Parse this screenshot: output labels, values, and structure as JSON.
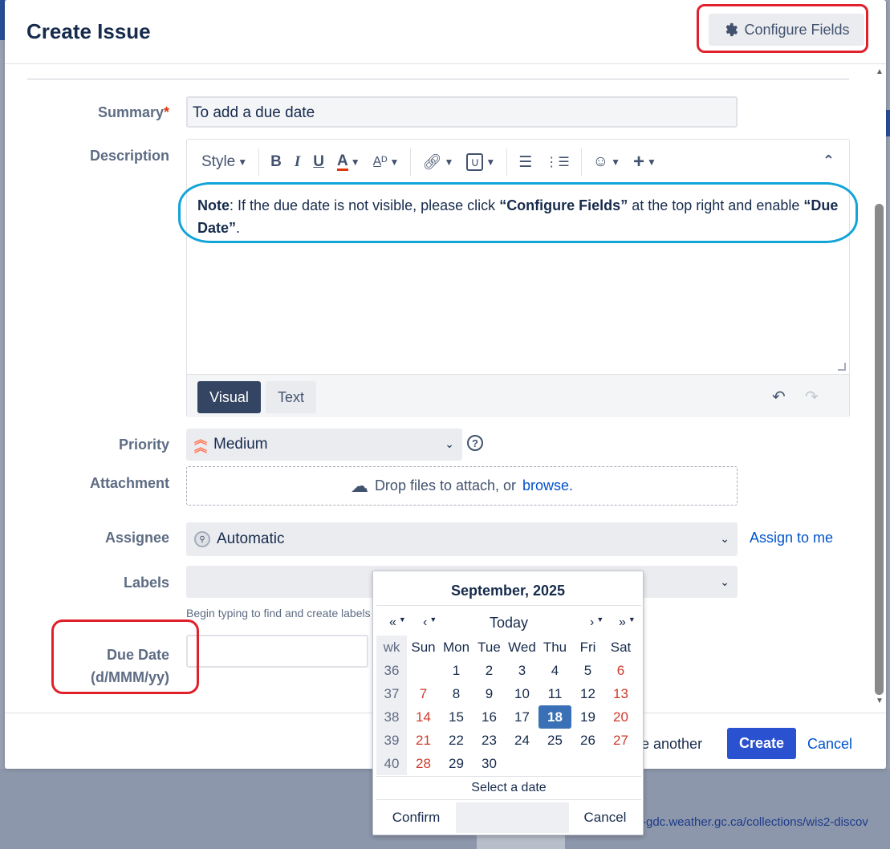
{
  "dialog": {
    "title": "Create Issue",
    "configure_fields_label": "Configure Fields"
  },
  "fields": {
    "summary": {
      "label": "Summary",
      "required_mark": "*",
      "value": "To add a due date"
    },
    "description": {
      "label": "Description",
      "toolbar": {
        "style_label": "Style"
      },
      "note_label": "Note",
      "note_text_1": ": If the due date is not visible, please click ",
      "note_bold_1": "“Configure Fields”",
      "note_text_2": " at the top right and enable ",
      "note_bold_2": "“Due Date”",
      "note_text_3": ".",
      "mode_visual": "Visual",
      "mode_text": "Text"
    },
    "priority": {
      "label": "Priority",
      "value": "Medium",
      "help": "?"
    },
    "attachment": {
      "label": "Attachment",
      "drop_text": "Drop files to attach, or",
      "browse_text": "browse."
    },
    "assignee": {
      "label": "Assignee",
      "value": "Automatic",
      "assign_to_me": "Assign to me"
    },
    "labels": {
      "label": "Labels",
      "hint": "Begin typing to find and create labels"
    },
    "due_date": {
      "label": "Due Date",
      "format": "(d/MMM/yy)"
    }
  },
  "footer": {
    "create_another": "te another",
    "create_label": "Create",
    "cancel_label": "Cancel"
  },
  "calendar": {
    "title": "September, 2025",
    "nav": {
      "prev_year": "«",
      "prev_month": "‹",
      "today": "Today",
      "next_month": "›",
      "next_year": "»"
    },
    "headers": [
      "wk",
      "Sun",
      "Mon",
      "Tue",
      "Wed",
      "Thu",
      "Fri",
      "Sat"
    ],
    "weeks": [
      {
        "wk": "36",
        "days": [
          "",
          "1",
          "2",
          "3",
          "4",
          "5",
          "6"
        ]
      },
      {
        "wk": "37",
        "days": [
          "7",
          "8",
          "9",
          "10",
          "11",
          "12",
          "13"
        ]
      },
      {
        "wk": "38",
        "days": [
          "14",
          "15",
          "16",
          "17",
          "18",
          "19",
          "20"
        ]
      },
      {
        "wk": "39",
        "days": [
          "21",
          "22",
          "23",
          "24",
          "25",
          "26",
          "27"
        ]
      },
      {
        "wk": "40",
        "days": [
          "28",
          "29",
          "30",
          "",
          "",
          "",
          ""
        ]
      }
    ],
    "selected_day": "18",
    "status": "Select a date",
    "confirm_label": "Confirm",
    "cancel_label": "Cancel"
  },
  "background": {
    "link_text": "-gdc.weather.gc.ca/collections/wis2-discov"
  },
  "colors": {
    "primary": "#2a51cf",
    "link": "#0052cc",
    "weekend": "#cd3a2c",
    "selected_day": "#3a70b5",
    "annotation_red": "#e0202a",
    "annotation_blue": "#12a4d8"
  }
}
